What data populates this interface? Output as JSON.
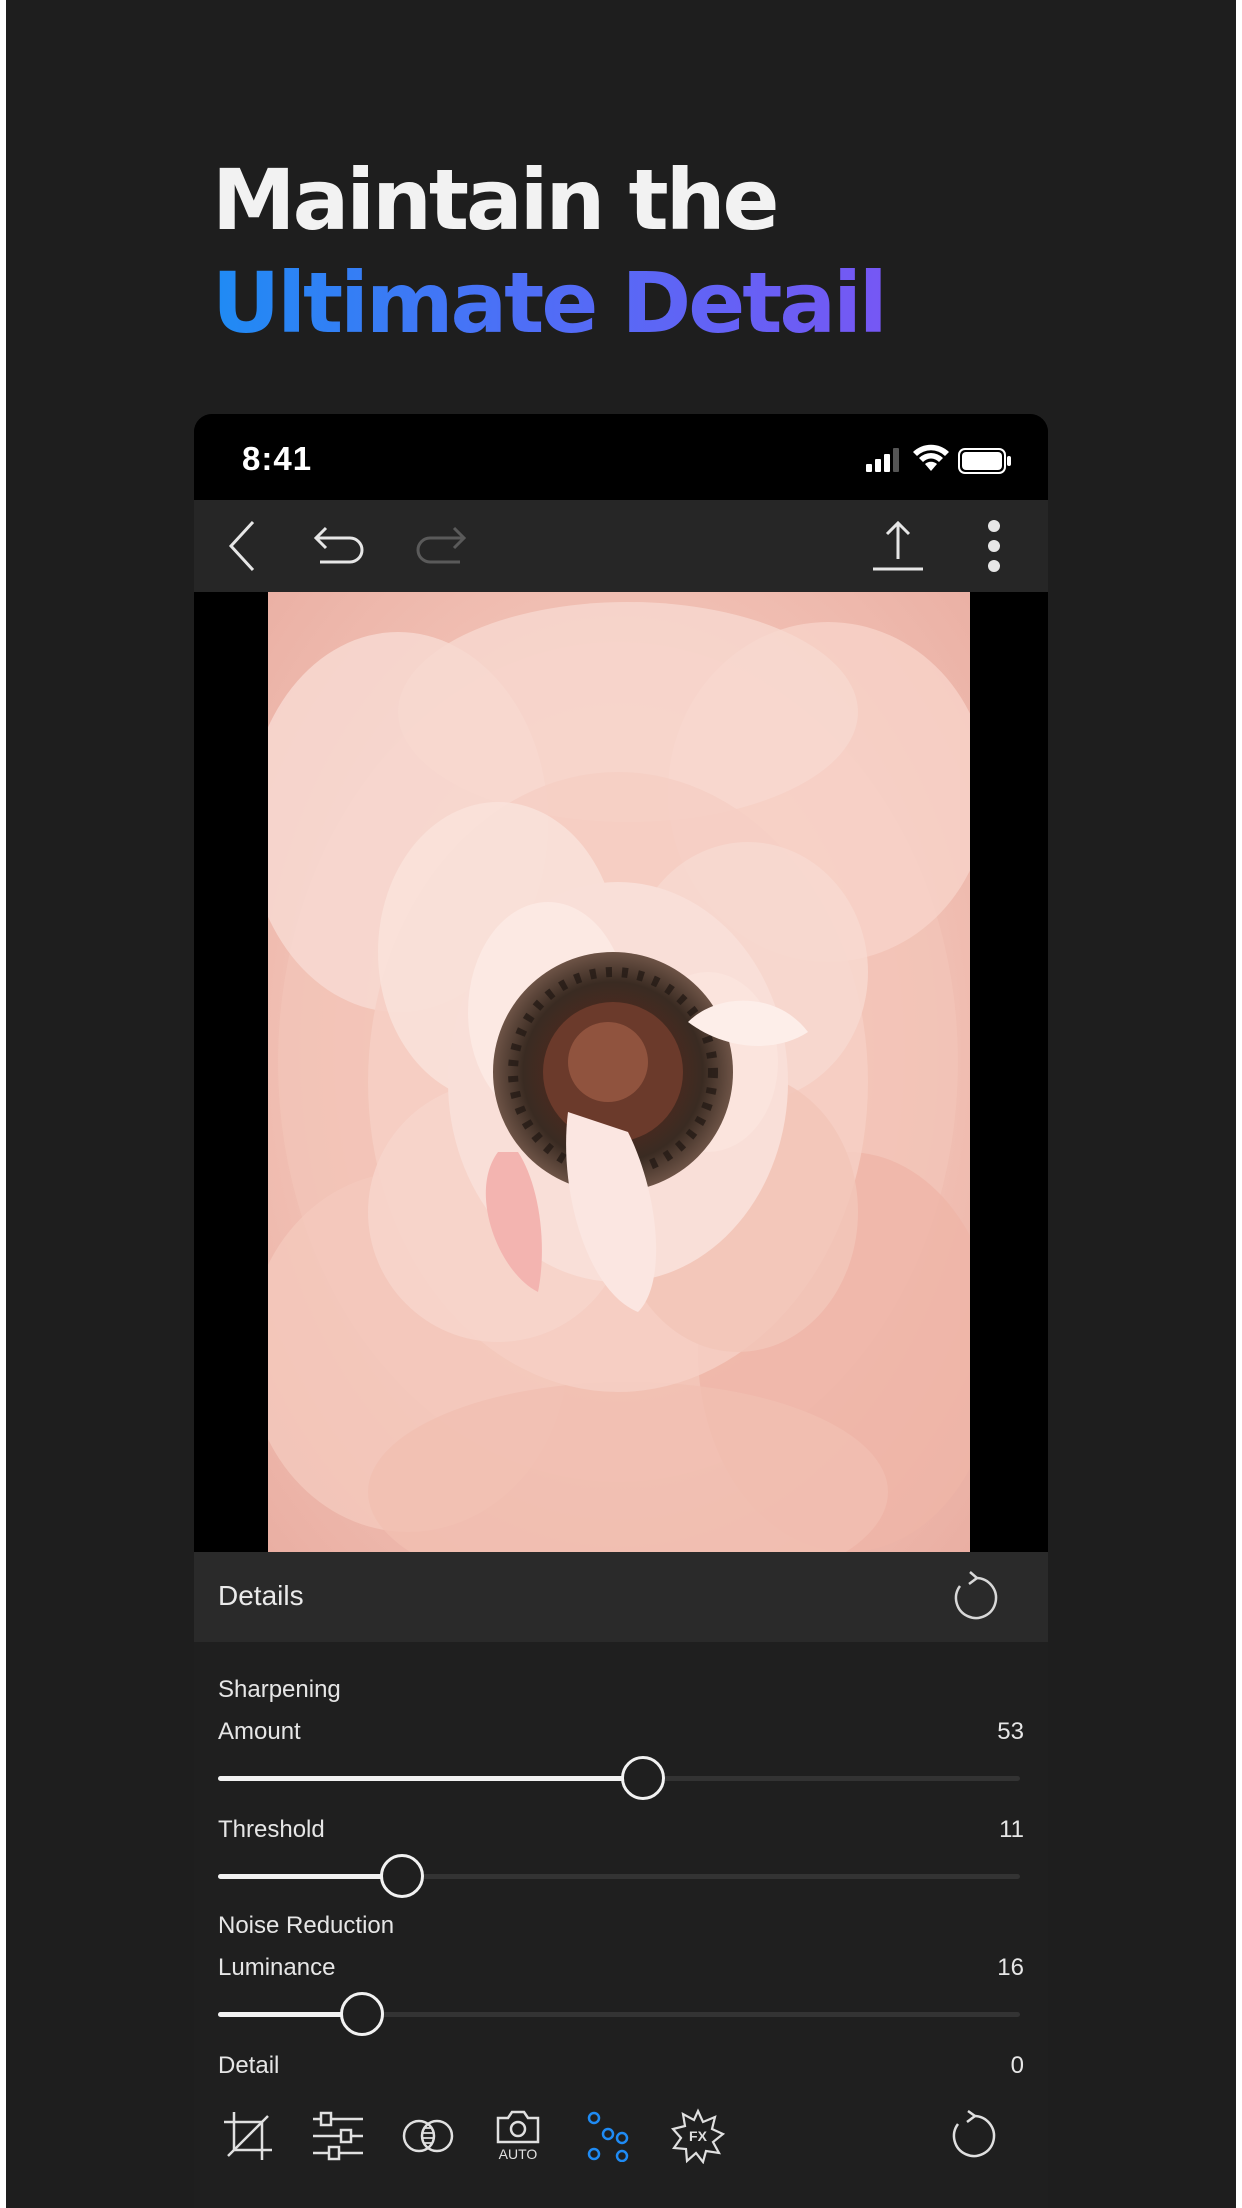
{
  "headline": {
    "line1": "Maintain the",
    "line2": "Ultimate Detail"
  },
  "status_bar": {
    "time": "8:41"
  },
  "toolbar": {
    "icons": [
      "back-icon",
      "undo-icon",
      "redo-icon",
      "share-icon",
      "more-icon"
    ]
  },
  "details_panel": {
    "title": "Details",
    "sharpening": {
      "section_label": "Sharpening",
      "amount": {
        "label": "Amount",
        "value": "53",
        "level": 0.53
      },
      "threshold": {
        "label": "Threshold",
        "value": "11",
        "level": 0.23
      }
    },
    "noise_reduction": {
      "section_label": "Noise Reduction",
      "luminance": {
        "label": "Luminance",
        "value": "16",
        "level": 0.18
      },
      "detail": {
        "label": "Detail",
        "value": "0"
      }
    }
  },
  "bottom_tools": {
    "auto_label": "AUTO",
    "fx_label": "FX",
    "active_tool": "details-tool"
  },
  "colors": {
    "accent": "#1f8bf4",
    "gradient_end": "#7657f4",
    "panel_bg": "#1e1e1e"
  }
}
